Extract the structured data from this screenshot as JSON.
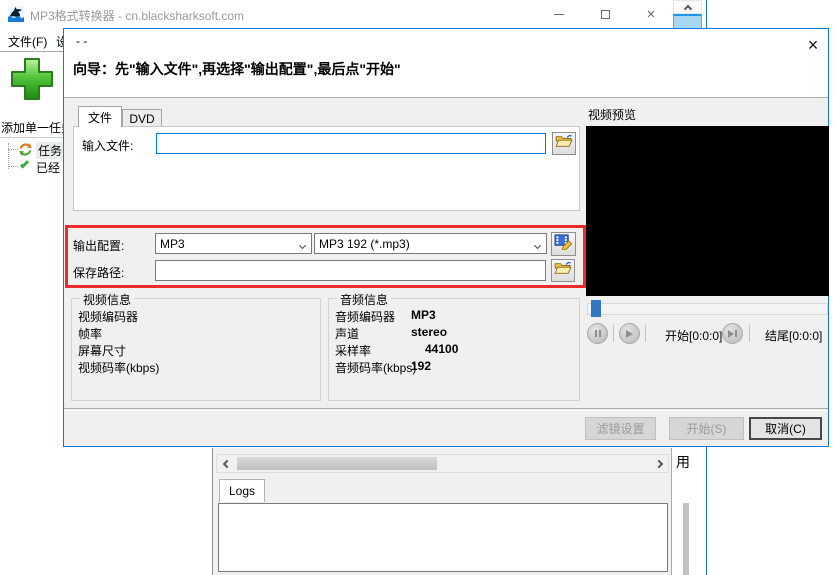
{
  "colors": {
    "accent": "#0078d7",
    "annotation_red": "#ee2b2b",
    "slider_thumb": "#2f77c2"
  },
  "window": {
    "title": "MP3格式转换器 - cn.blacksharksoft.com",
    "close_glyph": "×",
    "menu": {
      "file": "文件(F)",
      "partial": "设"
    },
    "toolbar": {
      "add_task": "添加单一任务"
    },
    "tree": {
      "tasks": "任务",
      "done": "已经"
    },
    "bottom": {
      "side_text": "用",
      "logs_tab": "Logs",
      "log_value": ""
    }
  },
  "dialog": {
    "title": "- -",
    "close_glyph": "×",
    "heading": "向导：先\"输入文件\",再选择\"输出配置\",最后点\"开始\"",
    "tabs": {
      "file": "文件",
      "dvd": "DVD"
    },
    "file_tab": {
      "input_label": "输入文件:",
      "input_value": ""
    },
    "output": {
      "label": "输出配置:",
      "format": "MP3",
      "profile": "MP3 192 (*.mp3)",
      "save_label": "保存路径:",
      "save_value": ""
    },
    "video_info": {
      "title": "视频信息",
      "rows": [
        {
          "label": "视频编码器",
          "value": ""
        },
        {
          "label": "帧率",
          "value": ""
        },
        {
          "label": "屏幕尺寸",
          "value": ""
        },
        {
          "label": "视频码率(kbps)",
          "value": ""
        }
      ]
    },
    "audio_info": {
      "title": "音频信息",
      "rows": [
        {
          "label": "音频编码器",
          "value": "MP3"
        },
        {
          "label": "声道",
          "value": "stereo"
        },
        {
          "label": "采样率",
          "value": "44100"
        },
        {
          "label": "音频码率(kbps)",
          "value": "192"
        }
      ]
    },
    "preview": {
      "title": "视频预览",
      "start": "开始[0:0:0]",
      "end": "结尾[0:0:0]"
    },
    "footer": {
      "filter": "滤镜设置",
      "start": "开始(S)",
      "cancel": "取消(C)"
    }
  }
}
